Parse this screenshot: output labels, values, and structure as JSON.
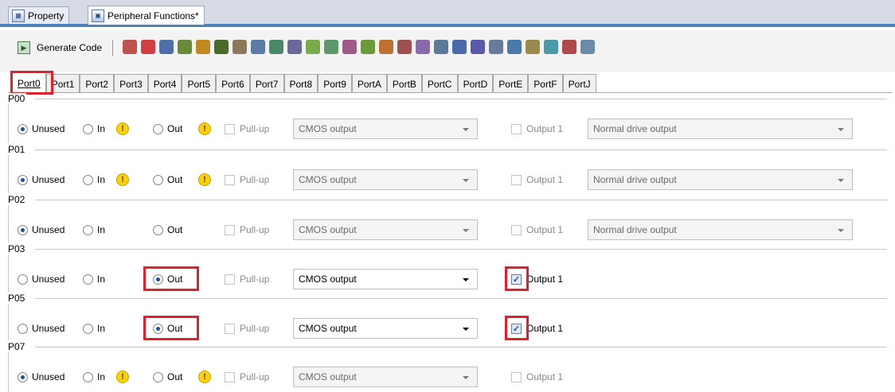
{
  "doc_tabs": [
    {
      "label": "Property",
      "icon": "property-icon"
    },
    {
      "label": "Peripheral Functions*",
      "icon": "peripheral-functions-icon"
    }
  ],
  "toolbar": {
    "generate_label": "Generate Code",
    "icon_colors": [
      "#c0504d",
      "#d04040",
      "#4f6fa8",
      "#6a8a3a",
      "#c08a20",
      "#4a6a2a",
      "#8a7a5a",
      "#5a7aa8",
      "#4a8a6a",
      "#6a6a9a",
      "#7aaa4a",
      "#5a9a6a",
      "#a05a8a",
      "#6a9a3a",
      "#c07030",
      "#a05050",
      "#8a6aaa",
      "#5a7a9a",
      "#4a6aaa",
      "#5a5aa8",
      "#6a7a9a",
      "#4a7aaa",
      "#9a8a4a",
      "#4a9aaa",
      "#b04a4a",
      "#6a8aaa"
    ]
  },
  "port_tabs": [
    "Port0",
    "Port1",
    "Port2",
    "Port3",
    "Port4",
    "Port5",
    "Port6",
    "Port7",
    "Port8",
    "Port9",
    "PortA",
    "PortB",
    "PortC",
    "PortD",
    "PortE",
    "PortF",
    "PortJ"
  ],
  "active_port_tab": "Port0",
  "labels": {
    "unused": "Unused",
    "in": "In",
    "out": "Out",
    "pullup": "Pull-up",
    "output1": "Output 1",
    "warn_symbol": "!"
  },
  "pins": [
    {
      "name": "P00",
      "mode": "Unused",
      "output_type": "CMOS output",
      "output1_checked": false,
      "drive": "Normal drive output"
    },
    {
      "name": "P01",
      "mode": "Unused",
      "output_type": "CMOS output",
      "output1_checked": false,
      "drive": "Normal drive output"
    },
    {
      "name": "P02",
      "mode": "Unused",
      "output_type": "CMOS output",
      "output1_checked": false,
      "drive": "Normal drive output"
    },
    {
      "name": "P03",
      "mode": "Out",
      "output_type": "CMOS output",
      "output1_checked": true
    },
    {
      "name": "P05",
      "mode": "Out",
      "output_type": "CMOS output",
      "output1_checked": true
    },
    {
      "name": "P07",
      "mode": "Unused",
      "output_type": "CMOS output",
      "output1_checked": false
    }
  ],
  "highlight_color": "#e0202a"
}
